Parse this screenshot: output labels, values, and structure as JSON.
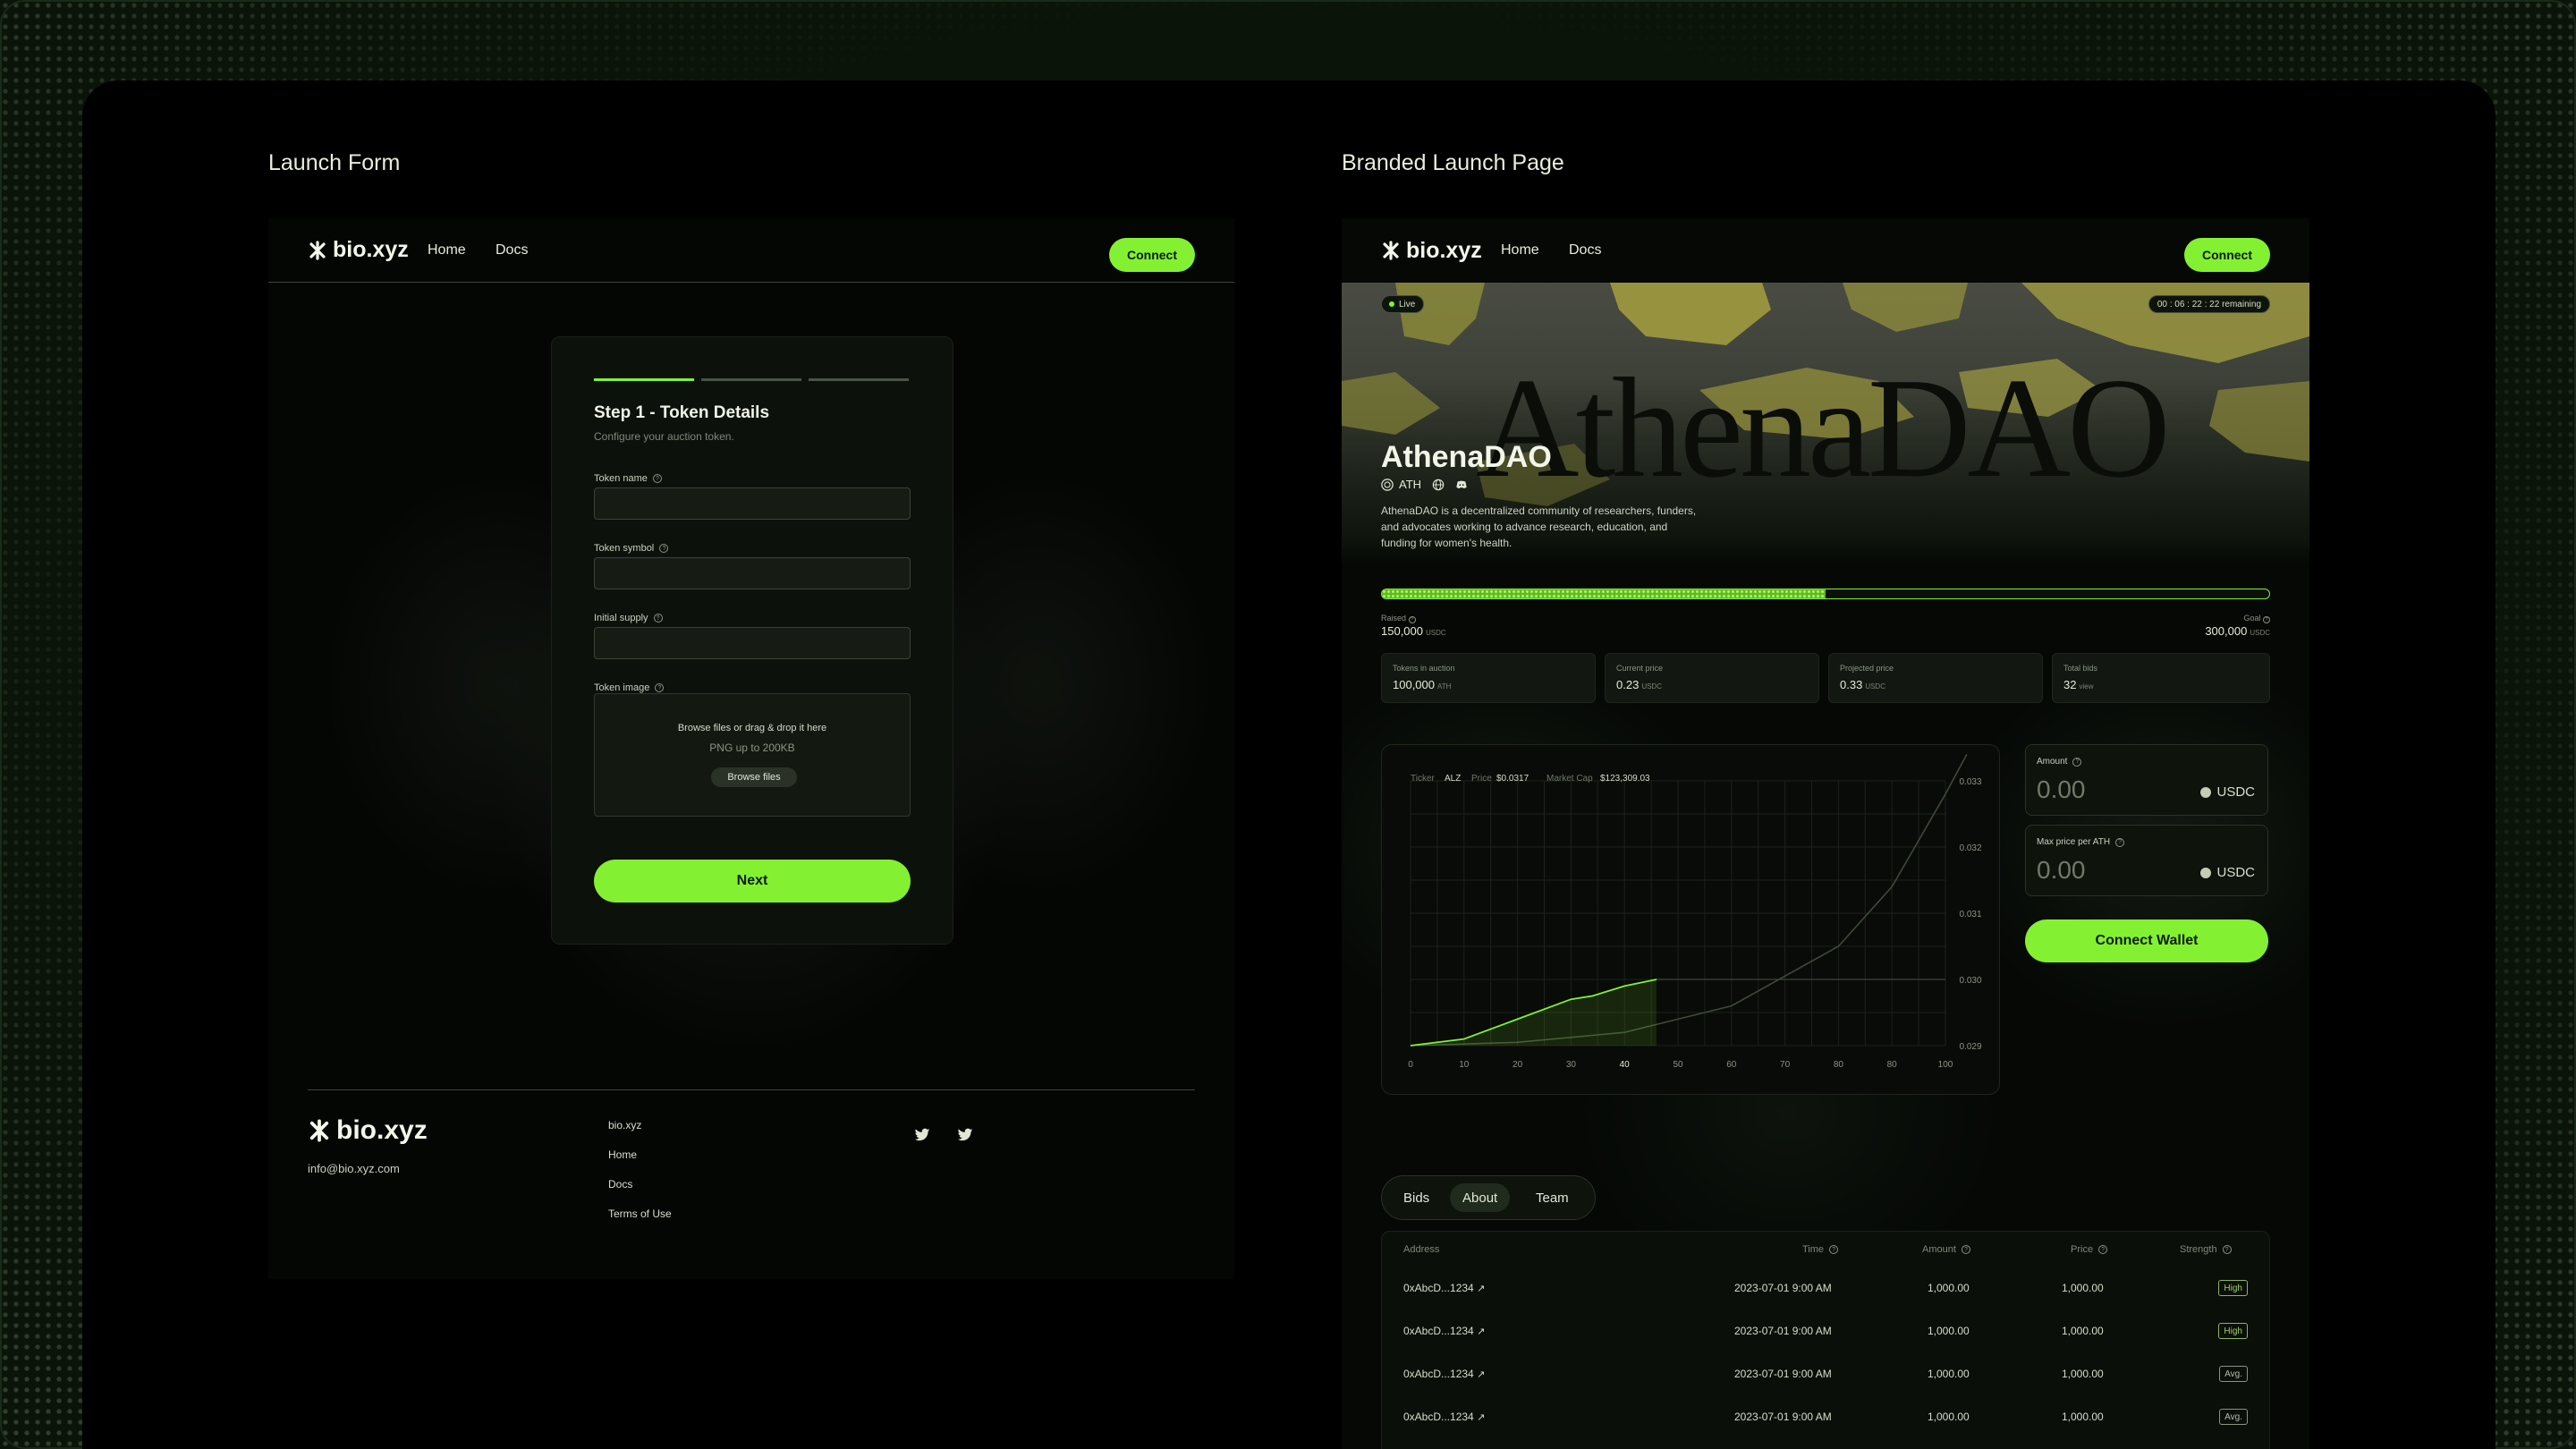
{
  "sections": {
    "launch_form": "Launch Form",
    "branded_page": "Branded Launch Page"
  },
  "nav": {
    "logo": "bio.xyz",
    "home": "Home",
    "docs": "Docs",
    "connect": "Connect"
  },
  "form": {
    "title": "Step 1 - Token Details",
    "subtitle": "Configure your auction token.",
    "fields": [
      {
        "label": "Token name",
        "value": ""
      },
      {
        "label": "Token symbol",
        "value": ""
      },
      {
        "label": "Initial supply",
        "value": ""
      }
    ],
    "image_label": "Token image",
    "dropzone_text": "Browse files or drag & drop it here",
    "dropzone_hint": "PNG up to 200KB",
    "browse_label": "Browse files",
    "next_label": "Next"
  },
  "footer": {
    "logo": "bio.xyz",
    "email": "info@bio.xyz.com",
    "links": [
      "bio.xyz",
      "Home",
      "Docs",
      "Terms of Use"
    ]
  },
  "launch": {
    "live": "Live",
    "timer": "00 : 06 : 22 : 22  remaining",
    "hero_text": "AthenaDAO",
    "title": "AthenaDAO",
    "ticker": "ATH",
    "description": "AthenaDAO is a decentralized community of researchers, funders, and advocates working to advance research, education, and funding for women's health.",
    "progress": 0.5,
    "raised_label": "Raised",
    "raised_value": "150,000",
    "raised_unit": "USDC",
    "goal_label": "Goal",
    "goal_value": "300,000",
    "goal_unit": "USDC",
    "stats": [
      {
        "label": "Tokens in auction",
        "value": "100,000",
        "unit": "ATH"
      },
      {
        "label": "Current price",
        "value": "0.23",
        "unit": "USDC"
      },
      {
        "label": "Projected price",
        "value": "0.33",
        "unit": "USDC"
      },
      {
        "label": "Total bids",
        "value": "32",
        "unit": "view"
      }
    ],
    "amount_label": "Amount",
    "amount_value": "0.00",
    "amount_currency": "USDC",
    "maxprice_label": "Max price per ATH",
    "maxprice_value": "0.00",
    "maxprice_currency": "USDC",
    "wallet_label": "Connect Wallet",
    "tabs": [
      "Bids",
      "About",
      "Team"
    ],
    "active_tab": "About"
  },
  "chart_data": {
    "type": "line",
    "header": {
      "ticker_label": "Ticker",
      "ticker": "ALZ",
      "price_label": "Price",
      "price": "$0.0317",
      "mcap_label": "Market Cap",
      "mcap": "$123,309.03"
    },
    "x_ticks": [
      "0",
      "10",
      "20",
      "30",
      "40",
      "50",
      "60",
      "70",
      "80",
      "80",
      "100"
    ],
    "y_ticks": [
      "0.033",
      "0.032",
      "0.031",
      "0.030",
      "0.029"
    ],
    "ylim": [
      0.029,
      0.033
    ],
    "xlim": [
      0,
      100
    ],
    "series": [
      {
        "values": [
          [
            0,
            0.029
          ],
          [
            10,
            0.0291
          ],
          [
            20,
            0.0294
          ],
          [
            30,
            0.0297
          ],
          [
            34,
            0.02975
          ],
          [
            40,
            0.0299
          ],
          [
            46,
            0.03
          ]
        ]
      },
      {
        "values": [
          [
            0,
            0.029
          ],
          [
            20,
            0.02905
          ],
          [
            40,
            0.0292
          ],
          [
            60,
            0.0296
          ],
          [
            80,
            0.0305
          ],
          [
            90,
            0.0314
          ],
          [
            100,
            0.0328
          ],
          [
            104,
            0.0334
          ]
        ]
      }
    ],
    "reference_y": 0.03
  },
  "bids_table": {
    "headers": [
      "Address",
      "Time",
      "Amount",
      "Price",
      "Strength"
    ],
    "rows": [
      {
        "address": "0xAbcD...1234",
        "time": "2023-07-01  9:00 AM",
        "amount": "1,000.00",
        "price": "1,000.00",
        "strength": "High"
      },
      {
        "address": "0xAbcD...1234",
        "time": "2023-07-01  9:00 AM",
        "amount": "1,000.00",
        "price": "1,000.00",
        "strength": "High"
      },
      {
        "address": "0xAbcD...1234",
        "time": "2023-07-01  9:00 AM",
        "amount": "1,000.00",
        "price": "1,000.00",
        "strength": "Avg."
      },
      {
        "address": "0xAbcD...1234",
        "time": "2023-07-01  9:00 AM",
        "amount": "1,000.00",
        "price": "1,000.00",
        "strength": "Avg."
      }
    ]
  },
  "colors": {
    "accent": "#84f032",
    "background": "#000000"
  }
}
